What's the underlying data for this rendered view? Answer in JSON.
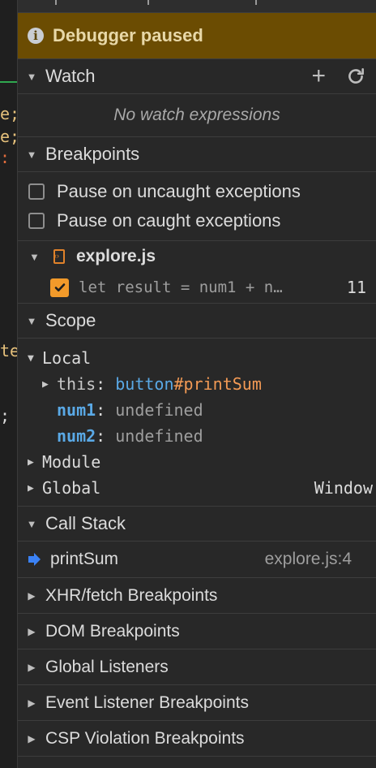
{
  "editor": {
    "fragments": [
      {
        "text": "e;",
        "color": "#e5c07b"
      },
      {
        "text": "e;",
        "color": "#e5c07b"
      },
      {
        "text": ":",
        "color": "#e06c3c"
      },
      {
        "text": "te",
        "color": "#e5c07b"
      },
      {
        "text": ";",
        "color": "#dcdcdc"
      }
    ]
  },
  "status": {
    "icon": "info-icon",
    "icon_glyph": "i",
    "text": "Debugger paused"
  },
  "watch": {
    "title": "Watch",
    "add_icon": "plus-icon",
    "refresh_icon": "refresh-icon",
    "empty": "No watch expressions"
  },
  "breakpoints": {
    "title": "Breakpoints",
    "options": [
      {
        "label": "Pause on uncaught exceptions",
        "checked": false
      },
      {
        "label": "Pause on caught exceptions",
        "checked": false
      }
    ],
    "file": "explore.js",
    "entry": {
      "code": "let result = num1 + n…",
      "line": "11",
      "checked": true
    }
  },
  "scope": {
    "title": "Scope",
    "local_label": "Local",
    "this_key": "this",
    "this_tag": "button",
    "this_id": "#printSum",
    "num1_key": "num1",
    "num1_val": "undefined",
    "num2_key": "num2",
    "num2_val": "undefined",
    "module_label": "Module",
    "global_label": "Global",
    "global_val": "Window"
  },
  "call_stack": {
    "title": "Call Stack",
    "frames": [
      {
        "name": "printSum",
        "location": "explore.js:4"
      }
    ]
  },
  "collapsed_sections": [
    "XHR/fetch Breakpoints",
    "DOM Breakpoints",
    "Global Listeners",
    "Event Listener Breakpoints",
    "CSP Violation Breakpoints"
  ],
  "colors": {
    "paused_banner": "#6b4c02",
    "accent_orange": "#f29a2a",
    "pointer_blue": "#3b82f6"
  }
}
